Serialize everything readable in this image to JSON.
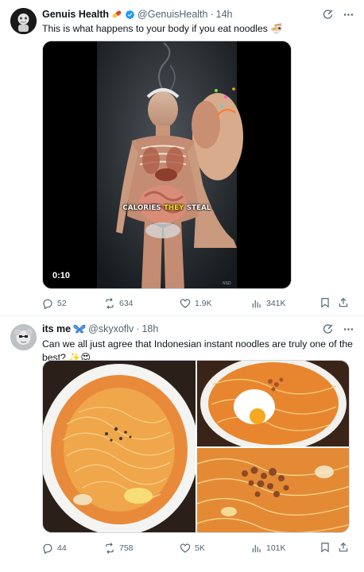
{
  "tweets": [
    {
      "author_name": "Genuis Health",
      "author_handle": "@GenuisHealth",
      "time": "14h",
      "separator": "·",
      "text": "This is what happens to your body if you eat noodles 🍜",
      "video": {
        "duration": "0:10",
        "caption_left": "CALORIES ",
        "caption_highlight": "THEY",
        "caption_right": " STEAL",
        "watermark": "NSD"
      },
      "replies": "52",
      "reposts": "634",
      "likes": "1.9K",
      "views": "341K"
    },
    {
      "author_name": "its me",
      "author_handle": "@skyxoflv",
      "time": "18h",
      "separator": "·",
      "text": "Can we all just agree that Indonesian instant noodles are truly one of the best? ✨😍",
      "replies": "44",
      "reposts": "758",
      "likes": "5K",
      "views": "101K"
    }
  ],
  "colors": {
    "text": "#0f1419",
    "muted": "#536471",
    "verified": "#1d9bf0",
    "border": "#eff3f4"
  },
  "icons": [
    "grok-icon",
    "more-icon",
    "reply-icon",
    "repost-icon",
    "like-icon",
    "views-icon",
    "bookmark-icon",
    "share-icon",
    "verified-badge-icon"
  ]
}
